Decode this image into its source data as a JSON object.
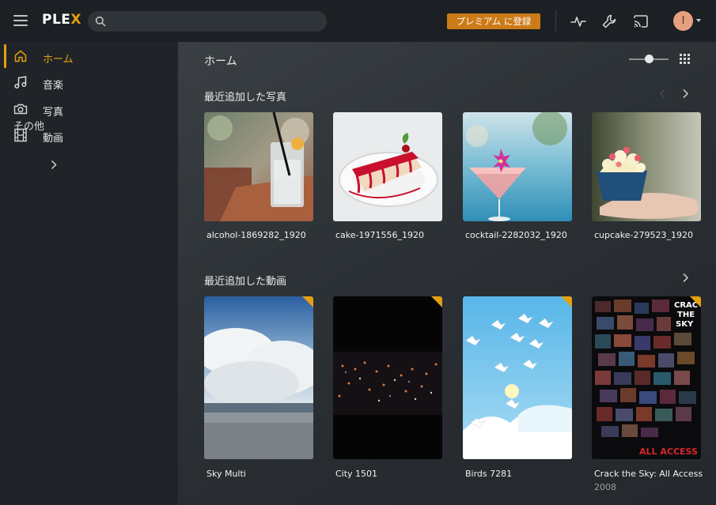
{
  "topbar": {
    "logo_text": "PLE",
    "logo_x": "X",
    "search_placeholder": "",
    "premium_label": "プレミアム に登録",
    "avatar_initial": "I"
  },
  "sidebar": {
    "items": [
      {
        "label": "ホーム",
        "icon": "home-icon",
        "active": true
      },
      {
        "label": "音楽",
        "icon": "music-icon",
        "active": false
      },
      {
        "label": "写真",
        "icon": "camera-icon",
        "active": false
      },
      {
        "label": "動画",
        "icon": "film-icon",
        "active": false
      }
    ],
    "other_label": "その他"
  },
  "main": {
    "title": "ホーム",
    "sections": [
      {
        "title": "最近追加した写真",
        "items": [
          {
            "label": "alcohol-1869282_1920",
            "sub": ""
          },
          {
            "label": "cake-1971556_1920",
            "sub": ""
          },
          {
            "label": "cocktail-2282032_1920",
            "sub": ""
          },
          {
            "label": "cupcake-279523_1920",
            "sub": ""
          }
        ]
      },
      {
        "title": "最近追加した動画",
        "items": [
          {
            "label": "Sky Multi",
            "sub": ""
          },
          {
            "label": "City 1501",
            "sub": ""
          },
          {
            "label": "Birds 7281",
            "sub": ""
          },
          {
            "label": "Crack the Sky: All Access",
            "sub": "2008"
          }
        ]
      }
    ]
  },
  "colors": {
    "accent": "#e5a00d",
    "premium": "#cc7b19",
    "topbar": "#1c2024",
    "sidebar": "#202428"
  }
}
